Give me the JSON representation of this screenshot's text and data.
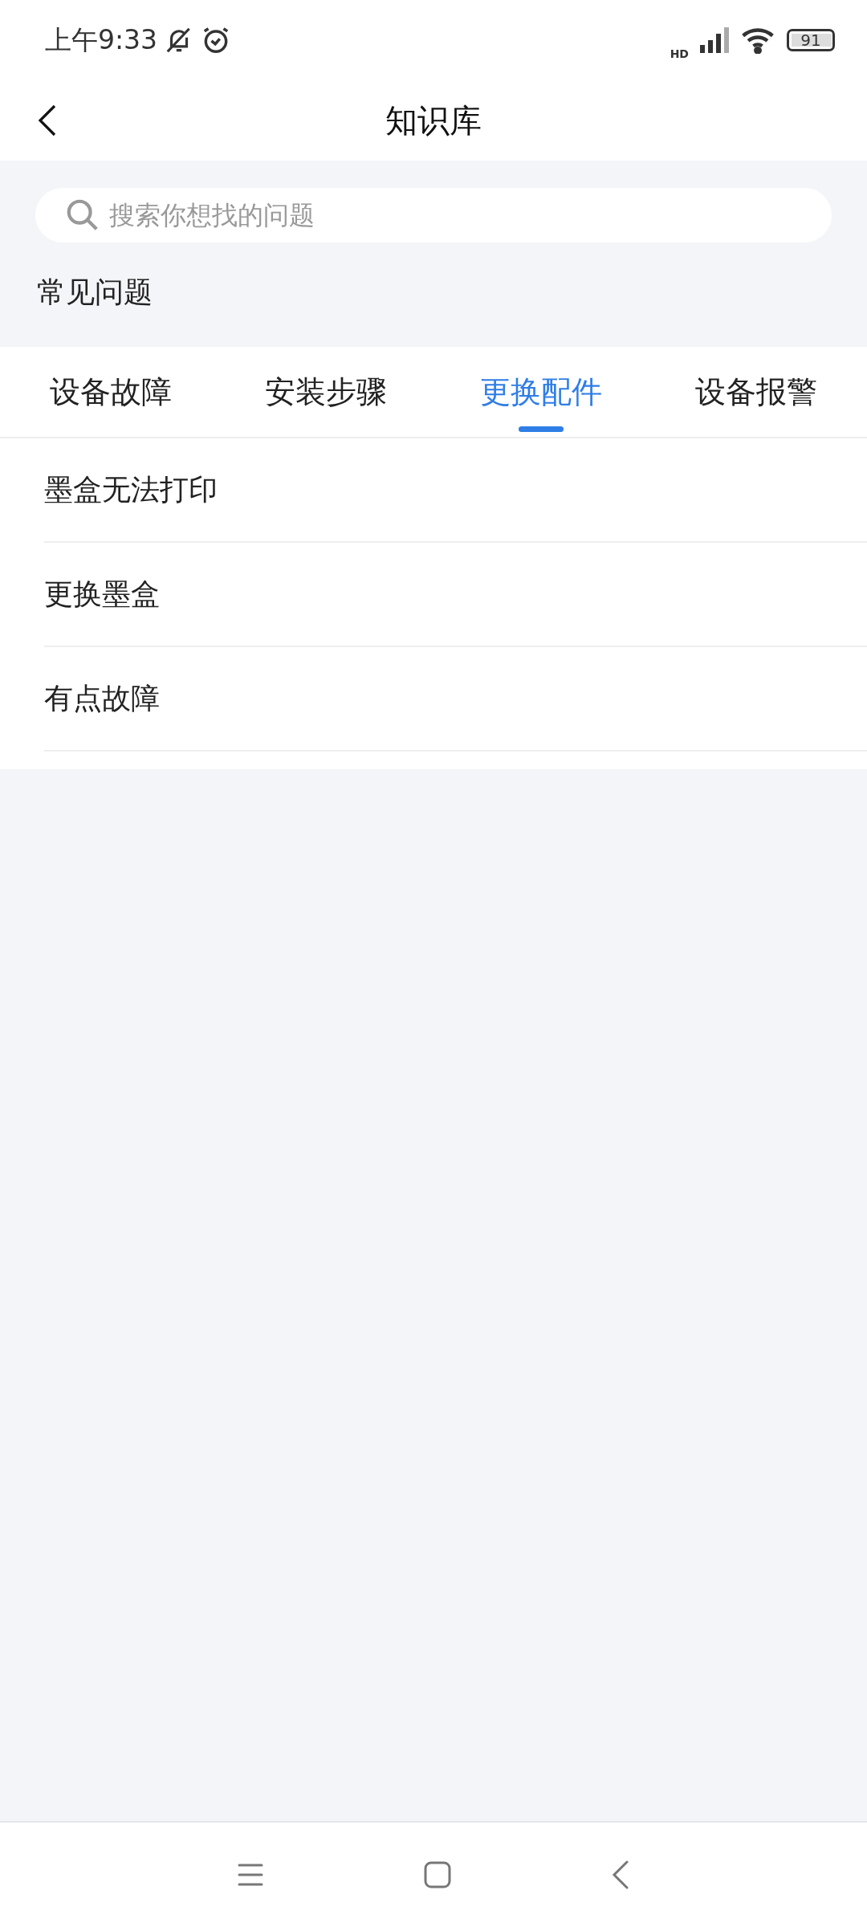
{
  "status_bar": {
    "time": "上午9:33",
    "network_label": "HD",
    "battery": "91"
  },
  "header": {
    "title": "知识库"
  },
  "search": {
    "placeholder": "搜索你想找的问题"
  },
  "section_title": "常见问题",
  "tabs": [
    {
      "label": "设备故障",
      "selected": false
    },
    {
      "label": "安装步骤",
      "selected": false
    },
    {
      "label": "更换配件",
      "selected": true
    },
    {
      "label": "设备报警",
      "selected": false
    }
  ],
  "items": [
    {
      "title": "墨盒无法打印"
    },
    {
      "title": "更换墨盒"
    },
    {
      "title": "有点故障"
    }
  ]
}
